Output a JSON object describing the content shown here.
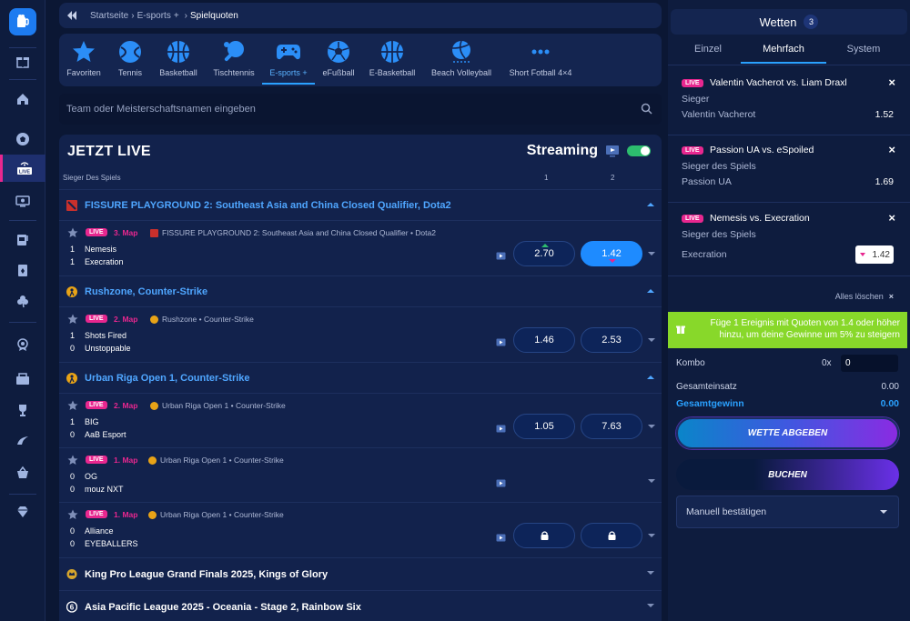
{
  "breadcrumb": {
    "items": [
      "Startseite",
      "E-sports",
      "Spielquoten"
    ],
    "sep1": "›",
    "plus": "+",
    "sep2": "›"
  },
  "sports": [
    {
      "label": "Favoriten",
      "icon": "star-icon"
    },
    {
      "label": "Tennis",
      "icon": "tennis-icon"
    },
    {
      "label": "Basketball",
      "icon": "basketball-icon"
    },
    {
      "label": "Tischtennis",
      "icon": "table-tennis-icon"
    },
    {
      "label": "E-sports +",
      "icon": "gamepad-icon",
      "active": true
    },
    {
      "label": "eFußball",
      "icon": "soccer-ball-icon"
    },
    {
      "label": "E-Basketball",
      "icon": "basketball-icon"
    },
    {
      "label": "Beach Volleyball",
      "icon": "volleyball-icon"
    },
    {
      "label": "Short Fotball 4×4",
      "icon": "more-icon"
    }
  ],
  "search": {
    "placeholder": "Team oder Meisterschaftsnamen eingeben"
  },
  "live": {
    "title": "JETZT LIVE",
    "streaming_label": "Streaming",
    "column_header": "Sieger Des Spiels",
    "col1": "1",
    "col2": "2",
    "live_badge": "LIVE",
    "leagues": [
      {
        "name": "FISSURE PLAYGROUND 2: Southeast Asia and China Closed Qualifier, Dota2"
      },
      {
        "name": "Rushzone, Counter-Strike"
      },
      {
        "name": "Urban Riga Open 1, Counter-Strike"
      },
      {
        "name": "King Pro League Grand Finals 2025, Kings of Glory"
      },
      {
        "name": "Asia Pacific League 2025 - Oceania - Stage 2, Rainbow Six"
      }
    ],
    "matches": [
      {
        "map": "3. Map",
        "tournament": "FISSURE PLAYGROUND 2: Southeast Asia and China Closed Qualifier",
        "game": "Dota2",
        "t1": "Nemesis",
        "s1": "1",
        "t2": "Execration",
        "s2": "1",
        "o1": "2.70",
        "o2": "1.42"
      },
      {
        "map": "2. Map",
        "tournament": "Rushzone",
        "game": "Counter-Strike",
        "t1": "Shots Fired",
        "s1": "1",
        "t2": "Unstoppable",
        "s2": "0",
        "o1": "1.46",
        "o2": "2.53"
      },
      {
        "map": "2. Map",
        "tournament": "Urban Riga Open 1",
        "game": "Counter-Strike",
        "t1": "BIG",
        "s1": "1",
        "t2": "AaB Esport",
        "s2": "0",
        "o1": "1.05",
        "o2": "7.63"
      },
      {
        "map": "1. Map",
        "tournament": "Urban Riga Open 1",
        "game": "Counter-Strike",
        "t1": "OG",
        "s1": "0",
        "t2": "mouz NXT",
        "s2": "0",
        "o1": "",
        "o2": ""
      },
      {
        "map": "1. Map",
        "tournament": "Urban Riga Open 1",
        "game": "Counter-Strike",
        "t1": "Alliance",
        "s1": "0",
        "t2": "EYEBALLERS",
        "s2": "0",
        "o1": "",
        "o2": ""
      }
    ],
    "dot": "•"
  },
  "slip": {
    "title": "Wetten",
    "count": "3",
    "tabs": [
      "Einzel",
      "Mehrfach",
      "System"
    ],
    "bets": [
      {
        "event": "Valentin Vacherot vs. Liam Draxl",
        "market": "Sieger",
        "selection": "Valentin Vacherot",
        "odd": "1.52"
      },
      {
        "event": "Passion UA vs. eSpoiled",
        "market": "Sieger des Spiels",
        "selection": "Passion UA",
        "odd": "1.69"
      },
      {
        "event": "Nemesis vs. Execration",
        "market": "Sieger des Spiels",
        "selection": "Execration",
        "odd": "1.42"
      }
    ],
    "clear_all": "Alles löschen",
    "close_x": "×",
    "promo": "Füge 1 Ereignis mit Quoten von 1.4 oder höher hinzu, um deine Gewinne um 5% zu steigern",
    "kombo_label": "Kombo",
    "kombo_mult": "0x",
    "kombo_value": "0",
    "total_stake_label": "Gesamteinsatz",
    "total_stake": "0.00",
    "total_win_label": "Gesamtgewinn",
    "total_win": "0.00",
    "place_bet": "WETTE ABGEBEN",
    "book": "BUCHEN",
    "confirm": "Manuell bestätigen"
  },
  "colors": {
    "accent": "#1e8bff",
    "live": "#e8278f",
    "promo": "#88d82a",
    "bg": "#0b1734"
  }
}
